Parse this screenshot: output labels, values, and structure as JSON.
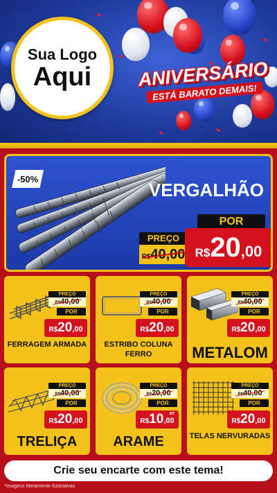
{
  "header": {
    "logo_line1": "Sua Logo",
    "logo_line2": "Aqui",
    "anniversary_title": "ANIVERSÁRIO",
    "anniversary_subtitle": "ESTÁ BARATO DEMAIS!"
  },
  "hero": {
    "discount": "-50%",
    "title": "VERGALHÃO",
    "preco_label": "PREÇO",
    "old_currency": "R$",
    "old_price": "40,00",
    "por_label": "POR",
    "currency": "R$",
    "price_int": "20",
    "price_cents": ",00"
  },
  "products": [
    {
      "name": "FERRAGEM ARMADA",
      "preco_label": "PREÇO",
      "old_currency": "R$",
      "old_price": "40,00",
      "por_label": "POR",
      "currency": "R$",
      "price_int": "20",
      "price_cents": ",00",
      "icon": "rebar-cage-icon"
    },
    {
      "name": "ESTRIBO COLUNA FERRO",
      "preco_label": "PREÇO",
      "old_currency": "R$",
      "old_price": "40,00",
      "por_label": "POR",
      "currency": "R$",
      "price_int": "20",
      "price_cents": ",00",
      "icon": "stirrup-icon"
    },
    {
      "name": "METALOM",
      "preco_label": "PREÇO",
      "old_currency": "R$",
      "old_price": "40,00",
      "por_label": "POR",
      "currency": "R$",
      "price_int": "20",
      "price_cents": ",00",
      "icon": "metal-tube-icon"
    },
    {
      "name": "TRELIÇA",
      "preco_label": "PREÇO",
      "old_currency": "R$",
      "old_price": "40,00",
      "por_label": "POR",
      "currency": "R$",
      "price_int": "20",
      "price_cents": ",00",
      "icon": "truss-icon"
    },
    {
      "name": "ARAME",
      "preco_label": "PREÇO",
      "old_currency": "R$",
      "old_price": "20,00",
      "por_label": "POR",
      "currency": "R$",
      "price_int": "10",
      "price_cents": ",00",
      "unit": "MT",
      "icon": "wire-coil-icon"
    },
    {
      "name": "TELAS NERVURADAS",
      "preco_label": "PREÇO",
      "old_currency": "R$",
      "old_price": "40,00",
      "por_label": "POR",
      "currency": "R$",
      "price_int": "20",
      "price_cents": ",00",
      "icon": "wire-mesh-icon"
    }
  ],
  "footer": {
    "cta": "Crie seu encarte com este tema!",
    "disclaimer": "*Imagens Meramente Ilustrativas"
  },
  "colors": {
    "brand_blue": "#1e3a9c",
    "brand_red": "#d4121e",
    "brand_yellow": "#f4c21a"
  }
}
